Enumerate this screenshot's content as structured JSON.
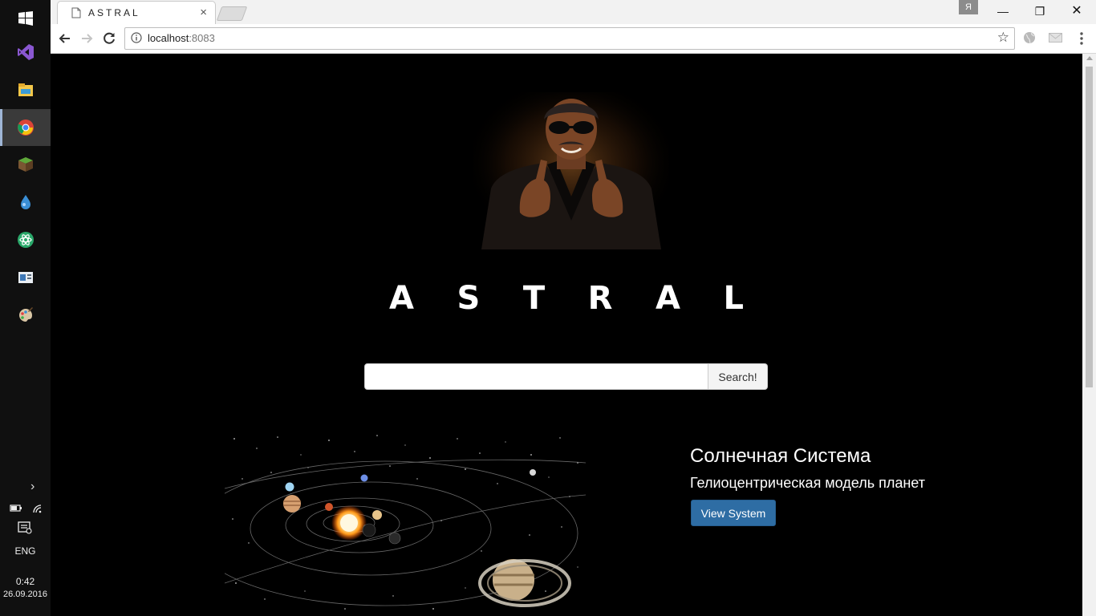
{
  "taskbar": {
    "apps": [
      {
        "icon": "windows-start-icon"
      },
      {
        "icon": "visual-studio-icon"
      },
      {
        "icon": "file-explorer-icon"
      },
      {
        "icon": "chrome-icon",
        "active": true
      },
      {
        "icon": "minecraft-icon"
      },
      {
        "icon": "water-drop-icon"
      },
      {
        "icon": "atom-icon"
      },
      {
        "icon": "news-app-icon"
      },
      {
        "icon": "paint-icon"
      }
    ],
    "tray": {
      "chevron": "›",
      "language": "ENG",
      "time": "0:42",
      "date": "26.09.2016"
    }
  },
  "browser": {
    "tab": {
      "title": "ASTRAL",
      "close": "×"
    },
    "profile_badge": "Я",
    "window_controls": {
      "minimize": "—",
      "restore": "❐",
      "close": "✕"
    },
    "address": {
      "host": "localhost",
      "port": ":8083"
    },
    "star": "☆"
  },
  "page": {
    "logo_text": "ASTRAL",
    "search": {
      "value": "",
      "placeholder": "",
      "button_label": "Search!"
    },
    "feature": {
      "title": "Солнечная Система",
      "subtitle": "Гелиоцентрическая модель планет",
      "button_label": "View System"
    }
  },
  "colors": {
    "page_background": "#000000",
    "primary_button": "#2e6da4",
    "taskbar": "#101010"
  }
}
